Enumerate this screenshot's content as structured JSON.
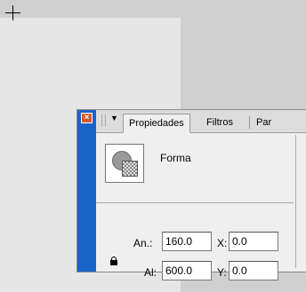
{
  "panel": {
    "tabs": [
      {
        "label": "Propiedades",
        "active": true
      },
      {
        "label": "Filtros",
        "active": false
      },
      {
        "label": "Par",
        "active": false
      }
    ],
    "object_type": "Forma",
    "fields": {
      "width_label": "An.:",
      "width_value": "160.0",
      "height_label": "Al:",
      "height_value": "600.0",
      "x_label": "X:",
      "x_value": "0.0",
      "y_label": "Y:",
      "y_value": "0.0"
    },
    "icons": [
      "close-icon",
      "collapse-arrow-icon",
      "shape-icon",
      "lock-icon"
    ]
  },
  "colors": {
    "side_strip": "#1a64c8",
    "close_button": "#d85a2a",
    "panel_bg": "#efefef",
    "stage_bg": "#cfcfcf"
  }
}
